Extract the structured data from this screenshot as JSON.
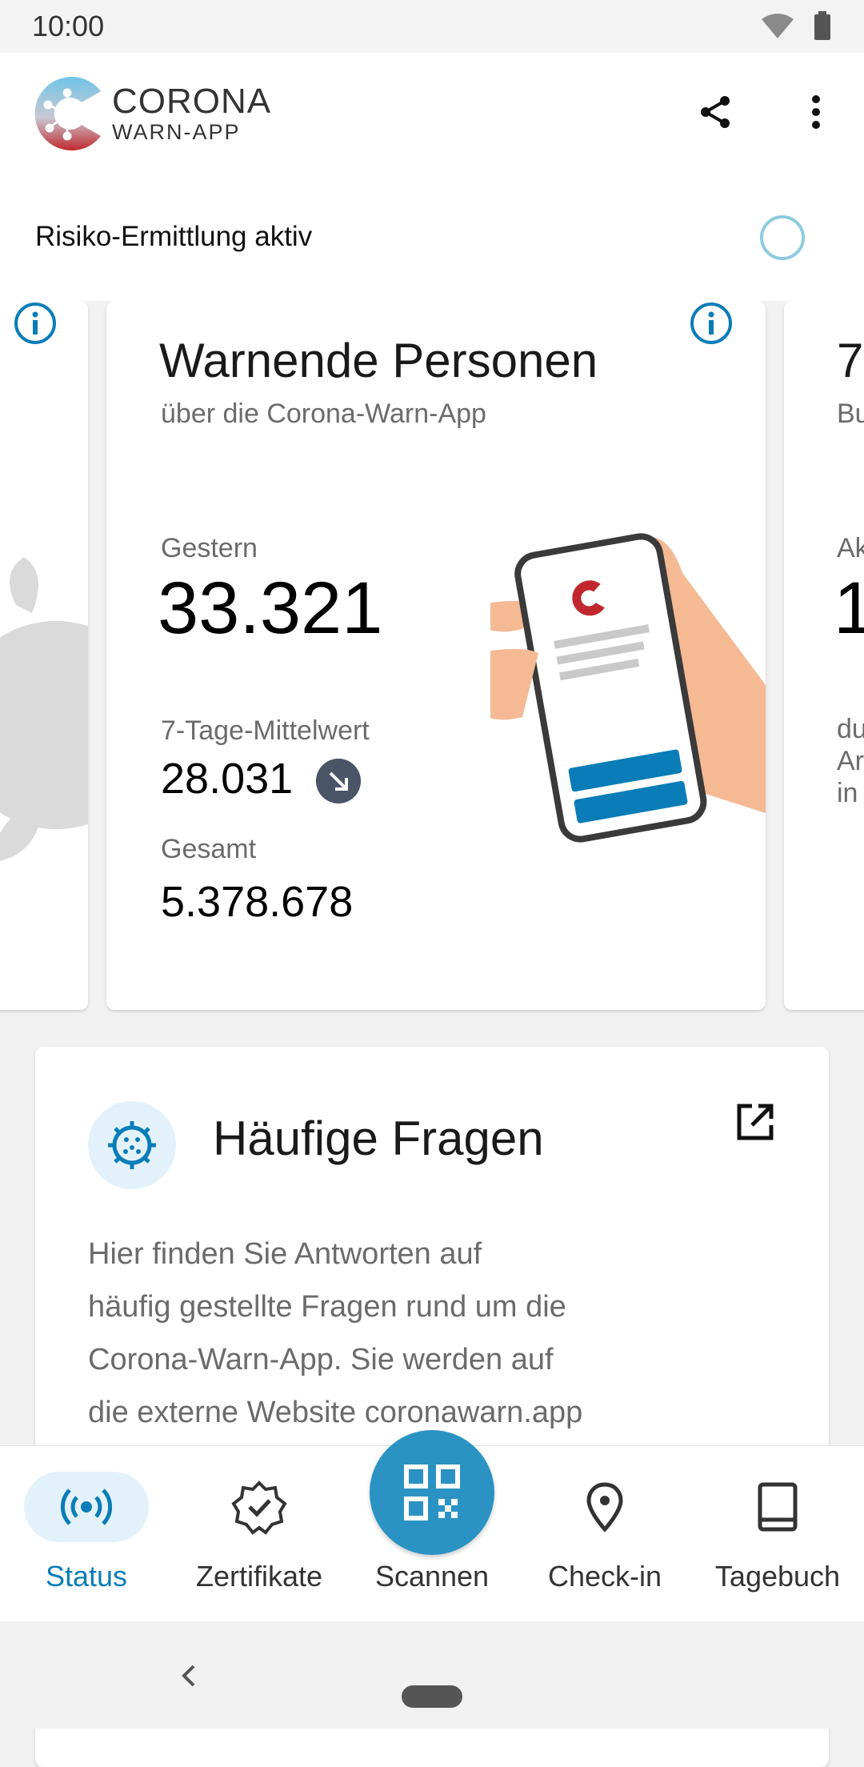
{
  "status_bar": {
    "time": "10:00"
  },
  "app_bar": {
    "logo_line1": "CORONA",
    "logo_line2": "WARN-APP",
    "share_icon": "share-icon",
    "more_icon": "more-vert-icon"
  },
  "risk": {
    "label": "Risiko-Ermittlung aktiv"
  },
  "stats_card": {
    "title": "Warnende Personen",
    "subtitle": "über die Corona-Warn-App",
    "yesterday_label": "Gestern",
    "yesterday_value": "33.321",
    "avg_label": "7-Tage-Mittelwert",
    "avg_value": "28.031",
    "avg_trend": "down",
    "total_label": "Gesamt",
    "total_value": "5.378.678"
  },
  "next_card": {
    "title": "7",
    "subtitle": "Bu",
    "label": "Ak",
    "value": "1",
    "text_lines": [
      "du",
      "Ar",
      "in"
    ]
  },
  "faq": {
    "title": "Häufige Fragen",
    "lines": [
      "Hier finden Sie Antworten auf",
      "häufig gestellte Fragen rund um die",
      "Corona-Warn-App. Sie werden auf",
      "die externe Website coronawarn.app"
    ]
  },
  "bottom_nav": [
    {
      "label": "Status",
      "icon": "broadcast-icon",
      "active": true
    },
    {
      "label": "Zertifikate",
      "icon": "verified-badge-icon",
      "active": false
    },
    {
      "label": "Scannen",
      "icon": "qr-code-icon",
      "active": false
    },
    {
      "label": "Check-in",
      "icon": "location-pin-icon",
      "active": false
    },
    {
      "label": "Tagebuch",
      "icon": "book-icon",
      "active": false
    }
  ],
  "colors": {
    "accent": "#0a7db8",
    "scan_button": "#2b93c4",
    "active_pill": "#e3f2fa",
    "risk_ring": "#8ecbe0"
  }
}
